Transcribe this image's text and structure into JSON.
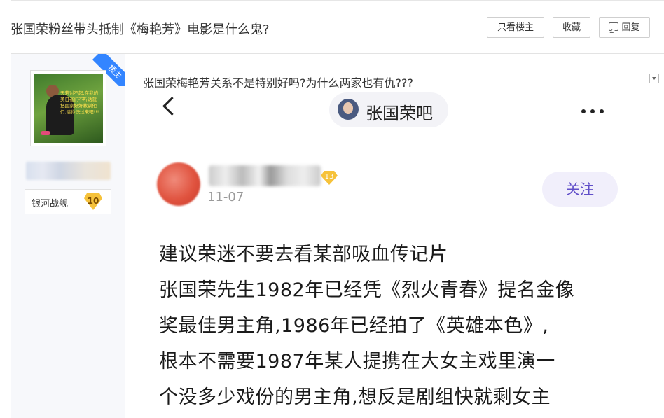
{
  "header": {
    "title": "张国荣粉丝带头抵制《梅艳芳》电影是什么鬼?",
    "only_op_label": "只看楼主",
    "favorite_label": "收藏",
    "reply_label": "回复"
  },
  "sidebar": {
    "op_ribbon": "楼主",
    "avatar_text": "天若对不起,在我的美日者们不听话就把国家好好教训他们,请你快过来吧!!!",
    "badge_name": "银河战舰",
    "badge_level": "10"
  },
  "post": {
    "text": "张国荣梅艳芳关系不是特别好吗?为什么两家也有仇???"
  },
  "screenshot": {
    "bar_name": "张国荣吧",
    "poster_level": "13",
    "date": "11-07",
    "follow_label": "关注",
    "lines": [
      "建议荣迷不要去看某部吸血传记片",
      "张国荣先生1982年已经凭《烈火青春》提名金像",
      "奖最佳男主角,1986年已经拍了《英雄本色》,",
      "根本不需要1987年某人提携在大女主戏里演一",
      "个没多少戏份的男主角,想反是剧组快就剩女主"
    ]
  }
}
